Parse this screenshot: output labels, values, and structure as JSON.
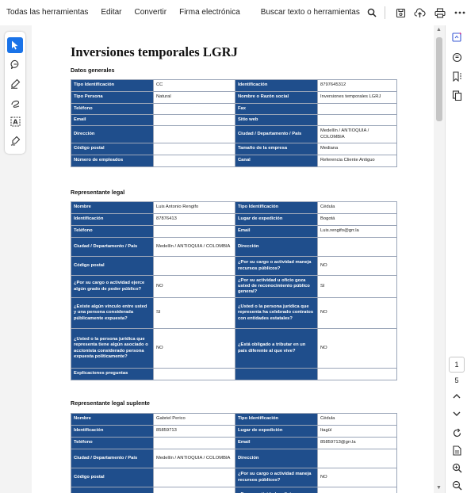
{
  "menu": {
    "all_tools": "Todas las herramientas",
    "edit": "Editar",
    "convert": "Convertir",
    "esign": "Firma electrónica",
    "search": "Buscar texto o herramientas"
  },
  "document": {
    "title": "Inversiones temporales LGRJ",
    "sections": {
      "general": "Datos generales",
      "legal_rep": "Representante legal",
      "legal_rep_alt": "Representante legal suplente"
    },
    "general_rows": [
      [
        "Tipo Identificación",
        "CC",
        "Identificación",
        "8797645312"
      ],
      [
        "Tipo Persona",
        "Natural",
        "Nombre o Razón social",
        "Inversiones temporales LGRJ"
      ],
      [
        "Teléfono",
        "",
        "Fax",
        ""
      ],
      [
        "Email",
        "",
        "Sitio web",
        ""
      ],
      [
        "Dirección",
        "",
        "Ciudad / Departamento / País",
        "Medellín / ANTIOQUIA / COLOMBIA"
      ],
      [
        "Código postal",
        "",
        "Tamaño de la empresa",
        "Mediana"
      ],
      [
        "Número de empleados",
        "",
        "Canal",
        "Referencia Cliente Antiguo"
      ]
    ],
    "rep_rows": [
      [
        "Nombre",
        "Luis Antonio Rengifo",
        "Tipo Identificación",
        "Cédula"
      ],
      [
        "Identificación",
        "87876413",
        "Lugar de expedición",
        "Bogotá"
      ],
      [
        "Teléfono",
        "",
        "Email",
        "Luis.rengifo@grr.la"
      ],
      [
        "Ciudad / Departamento / País",
        "Medellín / ANTIOQUIA / COLOMBIA",
        "Dirección",
        ""
      ],
      [
        "Código postal",
        "",
        "¿Por su cargo o actividad maneja recursos públicos?",
        "NO"
      ],
      [
        "¿Por su cargo o actividad ejerce algún grado de poder público?",
        "NO",
        "¿Por su actividad u oficio goza usted de reconocimiento público general?",
        "SI"
      ],
      [
        "¿Existe algún vínculo entre usted y una persona considerada públicamente expuesta?",
        "SI",
        "¿Usted o la persona jurídica que representa ha celebrado contratos con entidades estatales?",
        "NO"
      ],
      [
        "¿Usted o la persona jurídica que representa tiene algún asociado o accionista considerado persona expuesta políticamente?",
        "NO",
        "¿Está obligado a tributar en un país diferente al que vive?",
        "NO"
      ],
      [
        "Explicaciones preguntas",
        "",
        "",
        ""
      ]
    ],
    "alt_rows": [
      [
        "Nombre",
        "Gabriel Perico",
        "Tipo Identificación",
        "Cédula"
      ],
      [
        "Identificación",
        "85859713",
        "Lugar de expedición",
        "Itagüí"
      ],
      [
        "Teléfono",
        "",
        "Email",
        "85859713@grr.la"
      ],
      [
        "Ciudad / Departamento / País",
        "Medellín / ANTIOQUIA / COLOMBIA",
        "Dirección",
        ""
      ],
      [
        "Código postal",
        "",
        "¿Por su cargo o actividad maneja recursos públicos?",
        "NO"
      ],
      [
        "",
        "",
        "¿Por su actividad u oficio goza",
        ""
      ]
    ]
  },
  "pagination": {
    "current": "1",
    "total": "5"
  },
  "colors": {
    "label_bg": "#1f4e8c",
    "active_tool": "#1a73e8",
    "workspace_bg": "#f3f3f3"
  }
}
